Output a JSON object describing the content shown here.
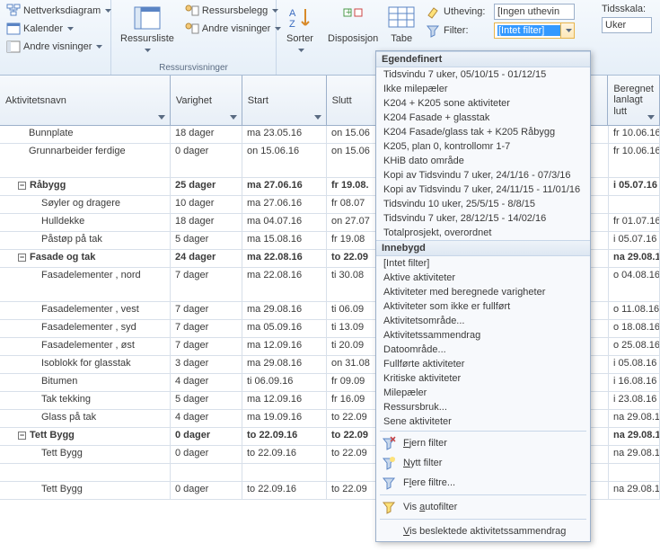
{
  "ribbon": {
    "g1": {
      "items": [
        "Nettverksdiagram",
        "Kalender",
        "Andre visninger"
      ]
    },
    "g2": {
      "big": "Ressursliste",
      "items": [
        "Ressursbelegg",
        "Andre visninger"
      ],
      "caption": "Ressursvisninger"
    },
    "g3": {
      "sort": "Sorter",
      "disp": "Disposisjon",
      "tbl": "Tabeller"
    },
    "g4": {
      "uth_lbl": "Utheving:",
      "uth_val": "[Ingen uthevin",
      "filter_lbl": "Filter:",
      "filter_val": "[Intet filter]"
    },
    "g5": {
      "lbl": "Tidsskala:",
      "val": "Uker"
    }
  },
  "columns": [
    "Aktivitetsnavn",
    "Varighet",
    "Start",
    "Slutt",
    "",
    "Beregnet planlagt slutt"
  ],
  "col5a": "Beregnet",
  "col5b": "lanlagt",
  "col5c": "lutt",
  "rows": [
    {
      "n": "Bunnplate",
      "in": 1,
      "v": "18 dager",
      "s": "ma 23.05.16",
      "sl": "on 15.06",
      "e": "fr 10.06.16"
    },
    {
      "n": "Grunnarbeider ferdige",
      "in": 1,
      "v": "0 dager",
      "s": "on 15.06.16",
      "sl": "on 15.06",
      "e": "fr 10.06.16",
      "dbl": true
    },
    {
      "n": "Råbygg",
      "in": 0,
      "b": true,
      "v": "25 dager",
      "s": "ma 27.06.16",
      "sl": "fr 19.08.",
      "e": "i 05.07.16"
    },
    {
      "n": "Søyler og dragere",
      "in": 2,
      "v": "10 dager",
      "s": "ma 27.06.16",
      "sl": "fr 08.07",
      "e": ""
    },
    {
      "n": "Hulldekke",
      "in": 2,
      "v": "18 dager",
      "s": "ma 04.07.16",
      "sl": "on 27.07",
      "e": "fr 01.07.16"
    },
    {
      "n": "Påstøp på tak",
      "in": 2,
      "v": "5 dager",
      "s": "ma 15.08.16",
      "sl": "fr 19.08",
      "e": "i 05.07.16"
    },
    {
      "n": "Fasade og tak",
      "in": 0,
      "b": true,
      "v": "24 dager",
      "s": "ma 22.08.16",
      "sl": "to 22.09",
      "e": "na 29.08.16"
    },
    {
      "n": "Fasadelementer , nord",
      "in": 2,
      "v": "7 dager",
      "s": "ma 22.08.16",
      "sl": "ti 30.08",
      "e": "o 04.08.16",
      "dbl": true
    },
    {
      "n": "Fasadelementer , vest",
      "in": 2,
      "v": "7 dager",
      "s": "ma 29.08.16",
      "sl": "ti 06.09",
      "e": "o 11.08.16"
    },
    {
      "n": "Fasadelementer , syd",
      "in": 2,
      "v": "7 dager",
      "s": "ma 05.09.16",
      "sl": "ti 13.09",
      "e": "o 18.08.16"
    },
    {
      "n": "Fasadelementer , øst",
      "in": 2,
      "v": "7 dager",
      "s": "ma 12.09.16",
      "sl": "ti 20.09",
      "e": "o 25.08.16"
    },
    {
      "n": "Isoblokk for glasstak",
      "in": 2,
      "v": "3 dager",
      "s": "ma 29.08.16",
      "sl": "on 31.08",
      "e": "i 05.08.16"
    },
    {
      "n": "Bitumen",
      "in": 2,
      "v": "4 dager",
      "s": "ti 06.09.16",
      "sl": "fr 09.09",
      "e": "i 16.08.16"
    },
    {
      "n": "Tak tekking",
      "in": 2,
      "v": "5 dager",
      "s": "ma 12.09.16",
      "sl": "fr 16.09",
      "e": "i   23.08.16"
    },
    {
      "n": "Glass på tak",
      "in": 2,
      "v": "4 dager",
      "s": "ma 19.09.16",
      "sl": "to 22.09",
      "e": "na 29.08.16"
    },
    {
      "n": "Tett Bygg",
      "in": 0,
      "b": true,
      "v": "0 dager",
      "s": "to 22.09.16",
      "sl": "to 22.09",
      "e": "na 29.08.16"
    },
    {
      "n": "Tett Bygg",
      "in": 2,
      "v": "0 dager",
      "s": "to 22.09.16",
      "sl": "to 22.09",
      "e": "na 29.08.16"
    },
    {
      "n": "",
      "in": 0,
      "v": "",
      "s": "",
      "sl": "",
      "e": ""
    },
    {
      "n": "Tett Bygg",
      "in": 2,
      "v": "0 dager",
      "s": "to 22.09.16",
      "sl": "to 22.09",
      "e": "na 29.08.16"
    }
  ],
  "menu": {
    "s1": "Egendefinert",
    "items1": [
      "Tidsvindu 7 uker, 05/10/15 - 01/12/15",
      "Ikke milepæler",
      "K204 + K205 sone aktiviteter",
      "K204 Fasade + glasstak",
      "K204 Fasade/glass tak + K205 Råbygg",
      "K205, plan 0, kontrollomr 1-7",
      "KHiB dato område",
      "Kopi av Tidsvindu 7 uker, 24/1/16 - 07/3/16",
      "Kopi av Tidsvindu 7 uker, 24/11/15 - 11/01/16",
      "Tidsvindu 10 uker, 25/5/15 - 8/8/15",
      "Tidsvindu 7 uker, 28/12/15 - 14/02/16",
      "Totalprosjekt, overordnet"
    ],
    "s2": "Innebygd",
    "items2": [
      "[Intet filter]",
      "Aktive aktiviteter",
      "Aktiviteter med beregnede varigheter",
      "Aktiviteter som ikke er fullført",
      "Aktivitetsområde...",
      "Aktivitetssammendrag",
      "Datoområde...",
      "Fullførte aktiviteter",
      "Kritiske aktiviteter",
      "Milepæler",
      "Ressursbruk...",
      "Sene aktiviteter"
    ],
    "cmd": {
      "clear": "Fjern filter",
      "clear_u": "F",
      "new": "Nytt filter",
      "new_u": "N",
      "more": "Flere filtre...",
      "more_u": "l",
      "auto": "Vis autofilter",
      "auto_u": "a",
      "rel": "Vis beslektede aktivitetssammendrag",
      "rel_u": "V"
    }
  }
}
